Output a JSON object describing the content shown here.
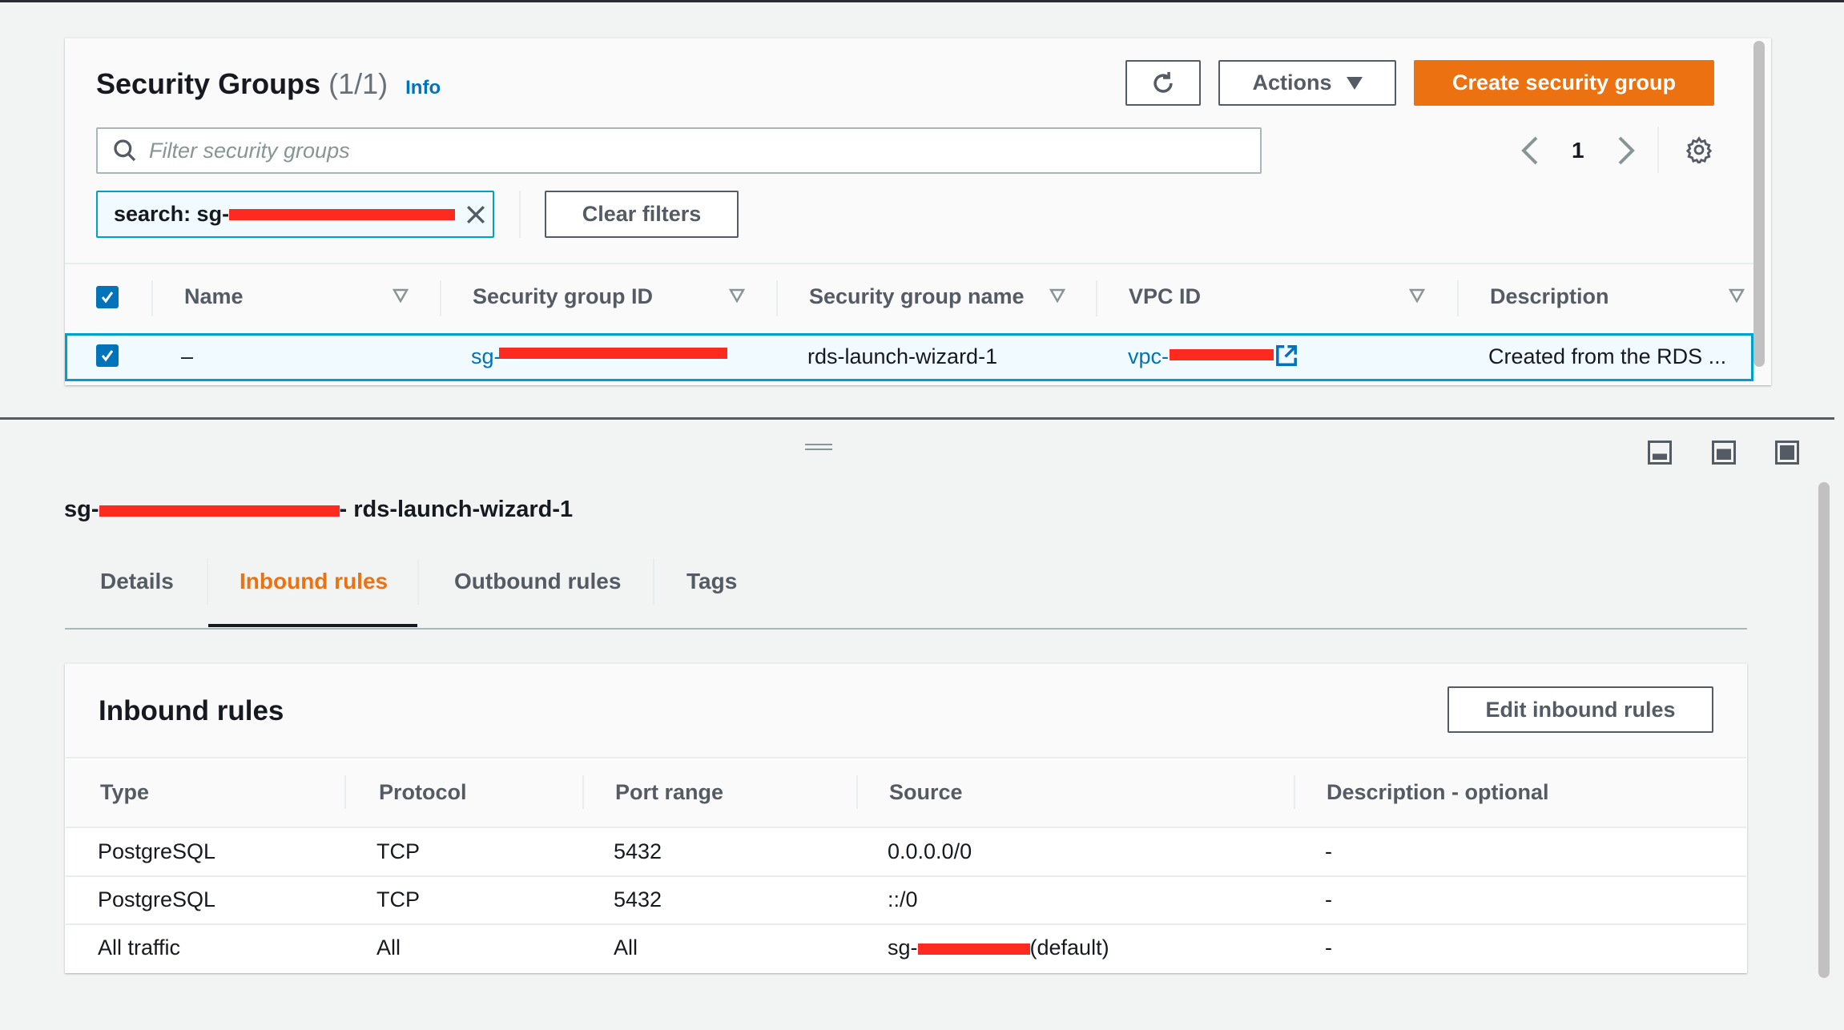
{
  "security_groups": {
    "title": "Security Groups",
    "count": "(1/1)",
    "info_label": "Info",
    "actions_label": "Actions",
    "create_label": "Create security group",
    "filter_placeholder": "Filter security groups",
    "filter_chip": "search: sg-",
    "clear_filters_label": "Clear filters",
    "page": "1",
    "columns": [
      "Name",
      "Security group ID",
      "Security group name",
      "VPC ID",
      "Description"
    ],
    "rows": [
      {
        "name": "–",
        "sg_id": "sg-",
        "sg_name": "rds-launch-wizard-1",
        "vpc_id": "vpc-",
        "description": "Created from the RDS ..."
      }
    ]
  },
  "details": {
    "title_prefix": "sg-",
    "title_suffix": "- rds-launch-wizard-1",
    "tabs": [
      "Details",
      "Inbound rules",
      "Outbound rules",
      "Tags"
    ],
    "active_tab": "Inbound rules",
    "inbound": {
      "title": "Inbound rules",
      "edit_label": "Edit inbound rules",
      "columns": [
        "Type",
        "Protocol",
        "Port range",
        "Source",
        "Description - optional"
      ],
      "rows": [
        {
          "type": "PostgreSQL",
          "protocol": "TCP",
          "port": "5432",
          "source": "0.0.0.0/0",
          "description": "-"
        },
        {
          "type": "PostgreSQL",
          "protocol": "TCP",
          "port": "5432",
          "source": "::/0",
          "description": "-"
        },
        {
          "type": "All traffic",
          "protocol": "All",
          "port": "All",
          "source": "sg-",
          "source_suffix": "(default)",
          "description": "-"
        }
      ]
    }
  },
  "colors": {
    "accent": "#ec7211",
    "link": "#0073bb",
    "redaction": "#ff2a1f"
  }
}
